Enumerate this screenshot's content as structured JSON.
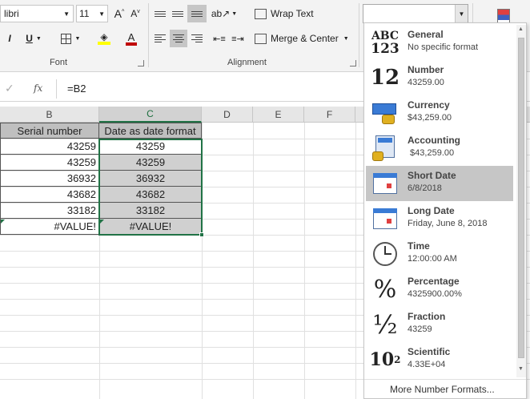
{
  "ribbon": {
    "font_name": "libri",
    "font_size": "11",
    "wrap_text": "Wrap Text",
    "merge_center": "Merge & Center",
    "groups": {
      "font": "Font",
      "alignment": "Alignment"
    },
    "font_color": "#c00000",
    "fill_color": "#ffff00",
    "accent": "#217346"
  },
  "formula_bar": {
    "fx": "fx",
    "formula": "=B2"
  },
  "sheet": {
    "columns": [
      "B",
      "C",
      "D",
      "E",
      "F"
    ],
    "selected_column": "C",
    "headers": {
      "b": "Serial number",
      "c": "Date as date format"
    },
    "rows": [
      {
        "b": "43259",
        "c": "43259"
      },
      {
        "b": "43259",
        "c": "43259"
      },
      {
        "b": "36932",
        "c": "36932"
      },
      {
        "b": "43682",
        "c": "43682"
      },
      {
        "b": "33182",
        "c": "33182"
      },
      {
        "b": "#VALUE!",
        "c": "#VALUE!"
      }
    ]
  },
  "number_format": {
    "current": "",
    "selected_item": "Short Date",
    "items": [
      {
        "name": "General",
        "sample": "No specific format",
        "icon": "general-abc123-icon"
      },
      {
        "name": "Number",
        "sample": "43259.00",
        "icon": "number-12-icon"
      },
      {
        "name": "Currency",
        "sample": "$43,259.00",
        "icon": "currency-money-icon"
      },
      {
        "name": "Accounting",
        "sample": " $43,259.00",
        "icon": "accounting-calculator-icon"
      },
      {
        "name": "Short Date",
        "sample": "6/8/2018",
        "icon": "short-date-calendar-icon"
      },
      {
        "name": "Long Date",
        "sample": "Friday, June 8, 2018",
        "icon": "long-date-calendar-icon"
      },
      {
        "name": "Time",
        "sample": "12:00:00 AM",
        "icon": "clock-icon"
      },
      {
        "name": "Percentage",
        "sample": "4325900.00%",
        "icon": "percent-icon"
      },
      {
        "name": "Fraction",
        "sample": "43259",
        "icon": "fraction-half-icon"
      },
      {
        "name": "Scientific",
        "sample": "4.33E+04",
        "icon": "scientific-10-squared-icon"
      }
    ],
    "more_formats": "More Number Formats...",
    "glyphs": {
      "general_top": "ABC",
      "general_bottom": "123",
      "number": "12",
      "percent": "%",
      "fraction": "½",
      "sci": "10",
      "sci_exp": "2"
    }
  }
}
